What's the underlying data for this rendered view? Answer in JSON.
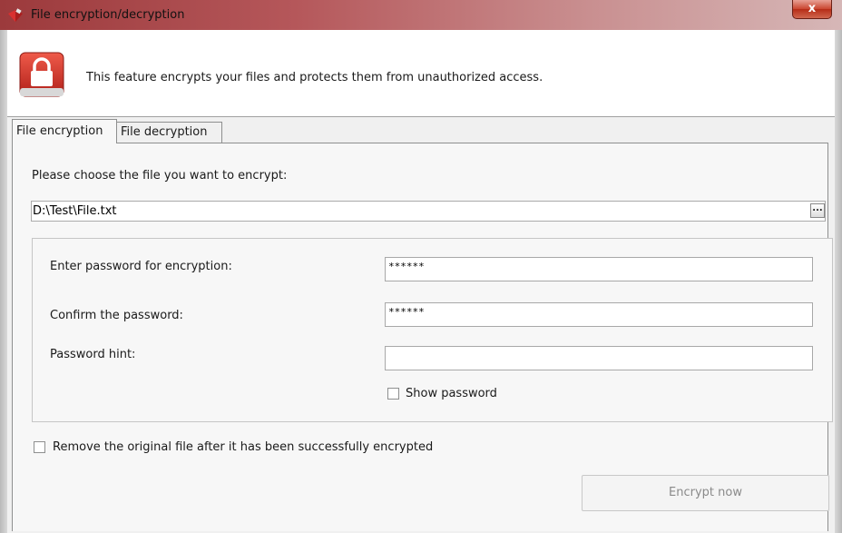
{
  "window": {
    "title": "File encryption/decryption",
    "close_label": "x",
    "accent_color": "#b5575a"
  },
  "header": {
    "icon": "lock-icon",
    "description": "This feature encrypts your files and protects them from unauthorized access."
  },
  "tabs": [
    {
      "label": "File encryption",
      "active": true
    },
    {
      "label": "File decryption",
      "active": false
    }
  ],
  "encryption": {
    "choose_label": "Please choose the file you want to encrypt:",
    "file_path": "D:\\Test\\File.txt",
    "browse_label": "...",
    "password_label": "Enter password for encryption:",
    "password_value": "******",
    "confirm_label": "Confirm the password:",
    "confirm_value": "******",
    "hint_label": "Password hint:",
    "hint_value": "",
    "show_password_label": "Show password",
    "show_password_checked": false,
    "remove_original_label": "Remove the original file after it has been successfully encrypted",
    "remove_original_checked": false,
    "encrypt_button_label": "Encrypt now",
    "encrypt_button_enabled": false
  }
}
